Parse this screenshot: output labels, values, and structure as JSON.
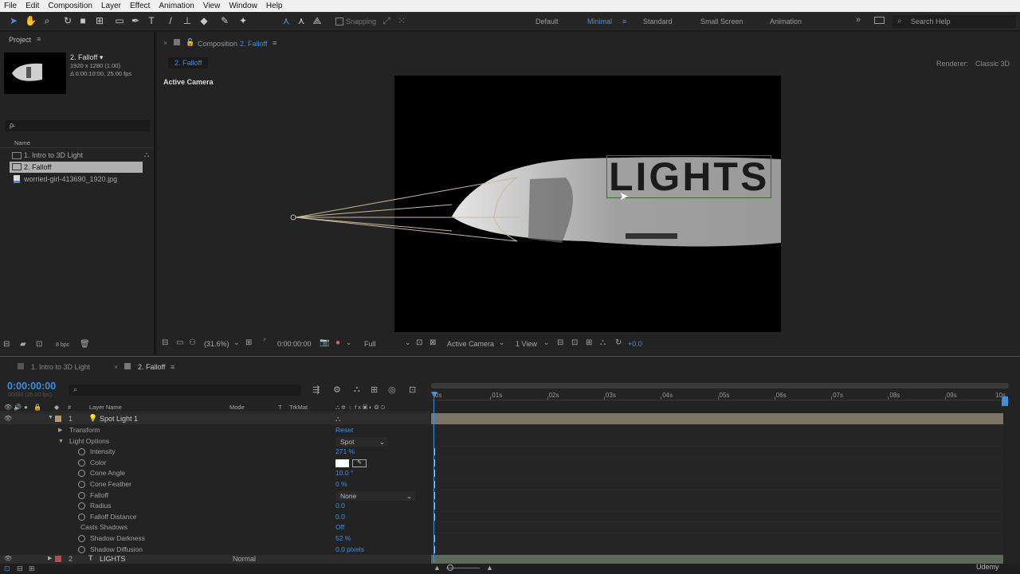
{
  "menu": [
    "File",
    "Edit",
    "Composition",
    "Layer",
    "Effect",
    "Animation",
    "View",
    "Window",
    "Help"
  ],
  "toolbar": {
    "snapping_label": "Snapping",
    "workspaces": [
      "Default",
      "Minimal",
      "Standard",
      "Small Screen",
      "Animation"
    ],
    "active_workspace": "Minimal",
    "search_placeholder": "Search Help"
  },
  "project": {
    "tab": "Project",
    "comp_name": "2. Falloff ▾",
    "comp_res": "1920 x 1280 (1.00)",
    "comp_dur": "Δ 0:00:10:00, 25.00 fps",
    "search_placeholder": "ρ̵",
    "col_name": "Name",
    "items": [
      "1. Intro to 3D Light",
      "2. Falloff",
      "worried-girl-413690_1920.jpg"
    ],
    "bpc": "8 bpc"
  },
  "comp": {
    "tab_prefix": "Composition",
    "tab_name": "2. Falloff",
    "sub_tab": "2. Falloff",
    "renderer_label": "Renderer:",
    "renderer_value": "Classic 3D",
    "view_label": "Active Camera",
    "canvas_text": "LIGHTS",
    "zoom": "(31.6%)",
    "timecode": "0:00:00:00",
    "resolution": "Full",
    "camera": "Active Camera",
    "views": "1 View",
    "exposure": "+0.0"
  },
  "timeline": {
    "tabs": [
      "1. Intro to 3D Light",
      "2. Falloff"
    ],
    "timecode": "0:00:00:00",
    "frames": "00000 (25.00 fps)",
    "columns": {
      "num": "#",
      "layer_name": "Layer Name",
      "mode": "Mode",
      "t": "T",
      "trkmat": "TrkMat"
    },
    "ruler": [
      "0s",
      "01s",
      "02s",
      "03s",
      "04s",
      "05s",
      "06s",
      "07s",
      "08s",
      "09s",
      "10s"
    ],
    "layers": [
      {
        "num": "1",
        "name": "Spot Light 1"
      },
      {
        "num": "2",
        "name": "LIGHTS",
        "mode": "Normal"
      }
    ],
    "props": [
      {
        "label": "Transform",
        "value": "Reset",
        "indent": 1,
        "kind": "group"
      },
      {
        "label": "Light Options",
        "value": "Spot",
        "indent": 1,
        "kind": "group-open"
      },
      {
        "label": "Intensity",
        "value": "271 %",
        "indent": 2,
        "kind": "prop"
      },
      {
        "label": "Color",
        "value": "",
        "indent": 2,
        "kind": "color"
      },
      {
        "label": "Cone Angle",
        "value": "10.0 °",
        "indent": 2,
        "kind": "prop"
      },
      {
        "label": "Cone Feather",
        "value": "0 %",
        "indent": 2,
        "kind": "prop"
      },
      {
        "label": "Falloff",
        "value": "None",
        "indent": 2,
        "kind": "dropdown"
      },
      {
        "label": "Radius",
        "value": "0.0",
        "indent": 2,
        "kind": "prop"
      },
      {
        "label": "Falloff Distance",
        "value": "0.0",
        "indent": 2,
        "kind": "prop"
      },
      {
        "label": "Casts Shadows",
        "value": "Off",
        "indent": 3,
        "kind": "static"
      },
      {
        "label": "Shadow Darkness",
        "value": "52 %",
        "indent": 2,
        "kind": "prop"
      },
      {
        "label": "Shadow Diffusion",
        "value": "0.0 pixels",
        "indent": 2,
        "kind": "prop"
      }
    ]
  },
  "watermark": "Udemy",
  "colors": {
    "accent": "#3f8fe0",
    "layer_bar": "#7d7468",
    "canvas": "#000000"
  }
}
